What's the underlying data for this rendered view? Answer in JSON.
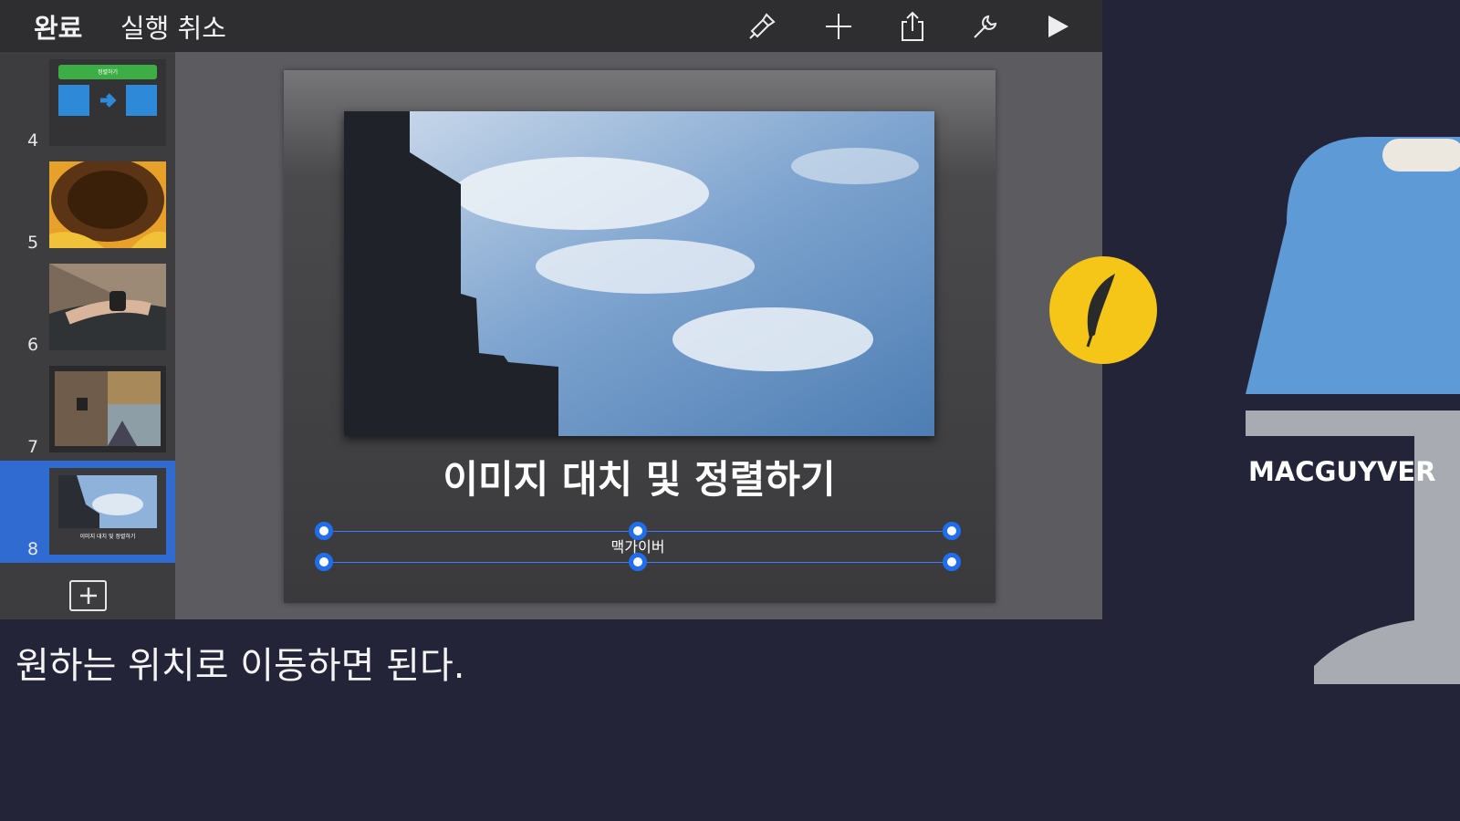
{
  "toolbar": {
    "done_label": "완료",
    "undo_label": "실행 취소",
    "icons": [
      "paintbrush-icon",
      "plus-icon",
      "share-icon",
      "wrench-icon",
      "play-icon"
    ]
  },
  "sidebar": {
    "slides": [
      {
        "number": "4",
        "thumb_text": "정렬하기"
      },
      {
        "number": "5"
      },
      {
        "number": "6"
      },
      {
        "number": "7"
      },
      {
        "number": "8",
        "selected": true,
        "thumb_text": "이미지 대치 및 정렬하기"
      }
    ],
    "add_icon": "add-slide-icon"
  },
  "slide": {
    "title": "이미지 대치 및 정렬하기",
    "subtitle": "맥가이버"
  },
  "caption": "원하는 위치로 이동하면 된다.",
  "brand": {
    "name": "MACGUYVER",
    "colors": {
      "logo_yellow": "#f5c518",
      "iron_blue": "#5d9ad6",
      "accent_selection": "#2f6bd1"
    }
  }
}
